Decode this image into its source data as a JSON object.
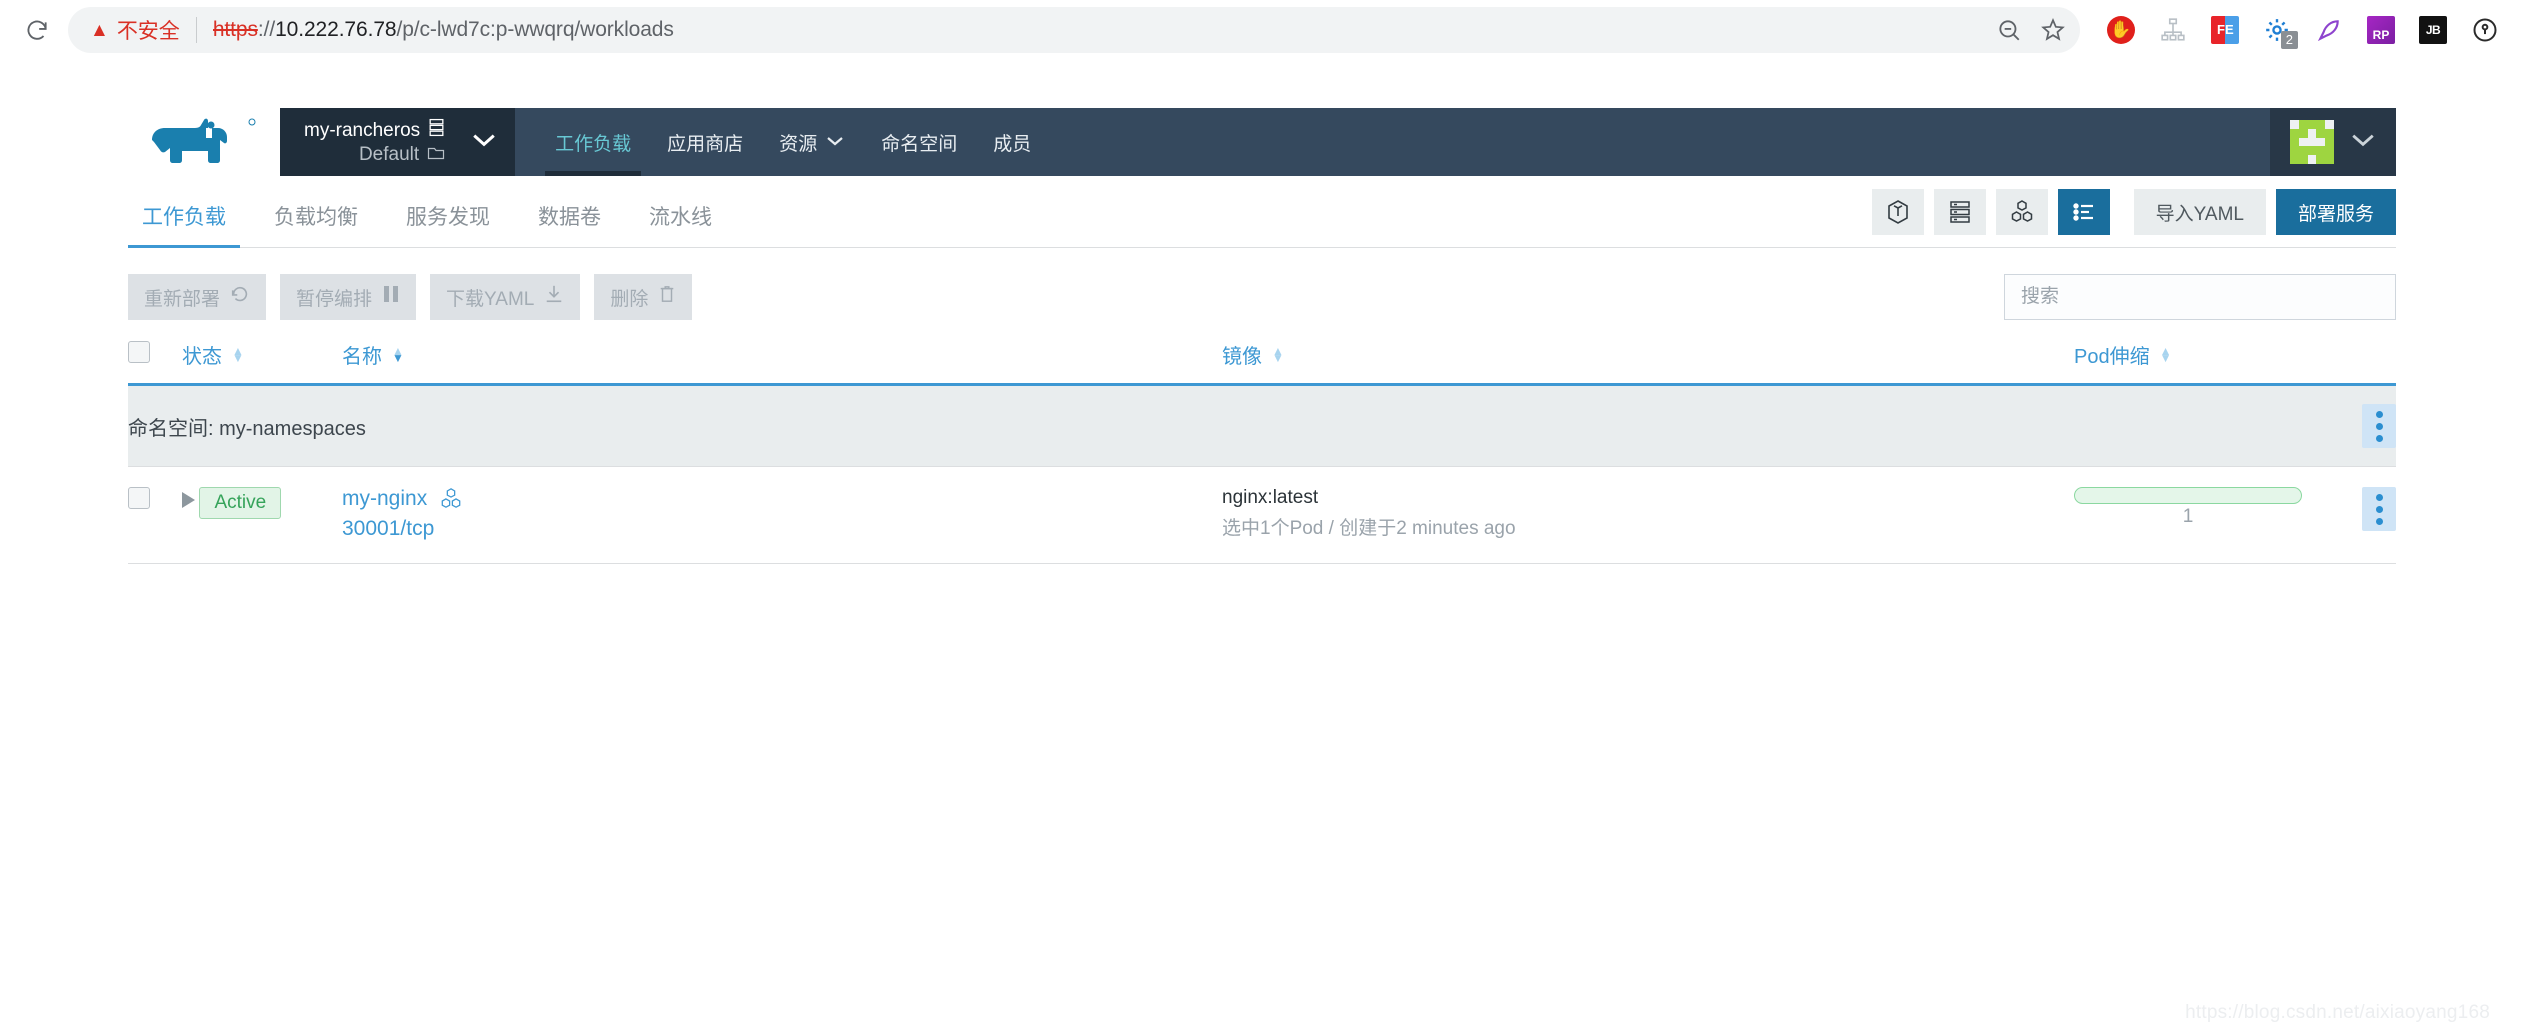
{
  "browser": {
    "reload_icon": "reload-icon",
    "security_label": "不安全",
    "warning_icon": "warning-triangle-icon",
    "url_scheme": "https",
    "url_sep": "://",
    "url_host": "10.222.76.78",
    "url_path": "/p/c-lwd7c:p-wwqrq/workloads",
    "zoom_out_icon": "zoom-out-icon",
    "bookmark_icon": "star-icon",
    "extensions": [
      {
        "name": "adblock-icon",
        "label": "✋"
      },
      {
        "name": "sitemap-icon",
        "label": ""
      },
      {
        "name": "fe-extension-icon",
        "label_left": "F",
        "label_right": "E"
      },
      {
        "name": "gear-extension-icon",
        "badge": "2"
      },
      {
        "name": "feather-extension-icon",
        "label": ""
      },
      {
        "name": "rp-extension-icon",
        "label": "RP"
      },
      {
        "name": "jetbrains-extension-icon",
        "label": "JB"
      },
      {
        "name": "password-manager-icon",
        "label": ""
      }
    ]
  },
  "header": {
    "logo": "rancher-cow-logo",
    "cluster_name": "my-rancheros",
    "cluster_icon": "server-icon",
    "project_name": "Default",
    "project_icon": "folder-icon",
    "dropdown_icon": "chevron-down-icon",
    "nav": [
      {
        "label": "工作负载",
        "active": true,
        "caret": false
      },
      {
        "label": "应用商店",
        "active": false,
        "caret": false
      },
      {
        "label": "资源",
        "active": false,
        "caret": true
      },
      {
        "label": "命名空间",
        "active": false,
        "caret": false
      },
      {
        "label": "成员",
        "active": false,
        "caret": false
      }
    ],
    "avatar_name": "user-avatar",
    "avatar_color": "#9ed540",
    "avatar_caret": "chevron-down-icon"
  },
  "tabs": [
    {
      "label": "工作负载",
      "active": true
    },
    {
      "label": "负载均衡",
      "active": false
    },
    {
      "label": "服务发现",
      "active": false
    },
    {
      "label": "数据卷",
      "active": false
    },
    {
      "label": "流水线",
      "active": false
    }
  ],
  "view_toggles": [
    {
      "name": "view-workload-icon",
      "active": false
    },
    {
      "name": "view-node-icon",
      "active": false
    },
    {
      "name": "view-group-icon",
      "active": false
    },
    {
      "name": "view-list-icon",
      "active": true
    }
  ],
  "toolbar": {
    "import_yaml_label": "导入YAML",
    "deploy_label": "部署服务"
  },
  "actions": [
    {
      "label": "重新部署",
      "icon": "redeploy-icon",
      "glyph": "↺",
      "disabled": true
    },
    {
      "label": "暂停编排",
      "icon": "pause-icon",
      "glyph": "❚❚",
      "disabled": true
    },
    {
      "label": "下载YAML",
      "icon": "download-icon",
      "glyph": "⤓",
      "disabled": true
    },
    {
      "label": "删除",
      "icon": "trash-icon",
      "glyph": "🗑",
      "disabled": true
    }
  ],
  "search": {
    "placeholder": "搜索",
    "value": ""
  },
  "table": {
    "columns": [
      {
        "key": "state",
        "label": "状态",
        "sorted": false
      },
      {
        "key": "name",
        "label": "名称",
        "sorted": true
      },
      {
        "key": "image",
        "label": "镜像",
        "sorted": false
      },
      {
        "key": "scale",
        "label": "Pod伸缩",
        "sorted": false
      }
    ],
    "group_label": "命名空间: my-namespaces",
    "rows": [
      {
        "state": "Active",
        "name": "my-nginx",
        "name_icon": "workload-scale-icon",
        "ports": "30001/tcp",
        "image": "nginx:latest",
        "image_sub": "选中1个Pod / 创建于2 minutes ago",
        "scale_count": "1"
      }
    ]
  },
  "watermark": "https://blog.csdn.net/aixiaoyang168",
  "colors": {
    "header_bg": "#35495e",
    "cluster_bg": "#1f2d3a",
    "accent_blue": "#3d98d3",
    "primary_btn": "#1a6e9d",
    "nav_active": "#68c8d4",
    "active_badge": "#35a35a",
    "danger_red": "#d93025"
  }
}
